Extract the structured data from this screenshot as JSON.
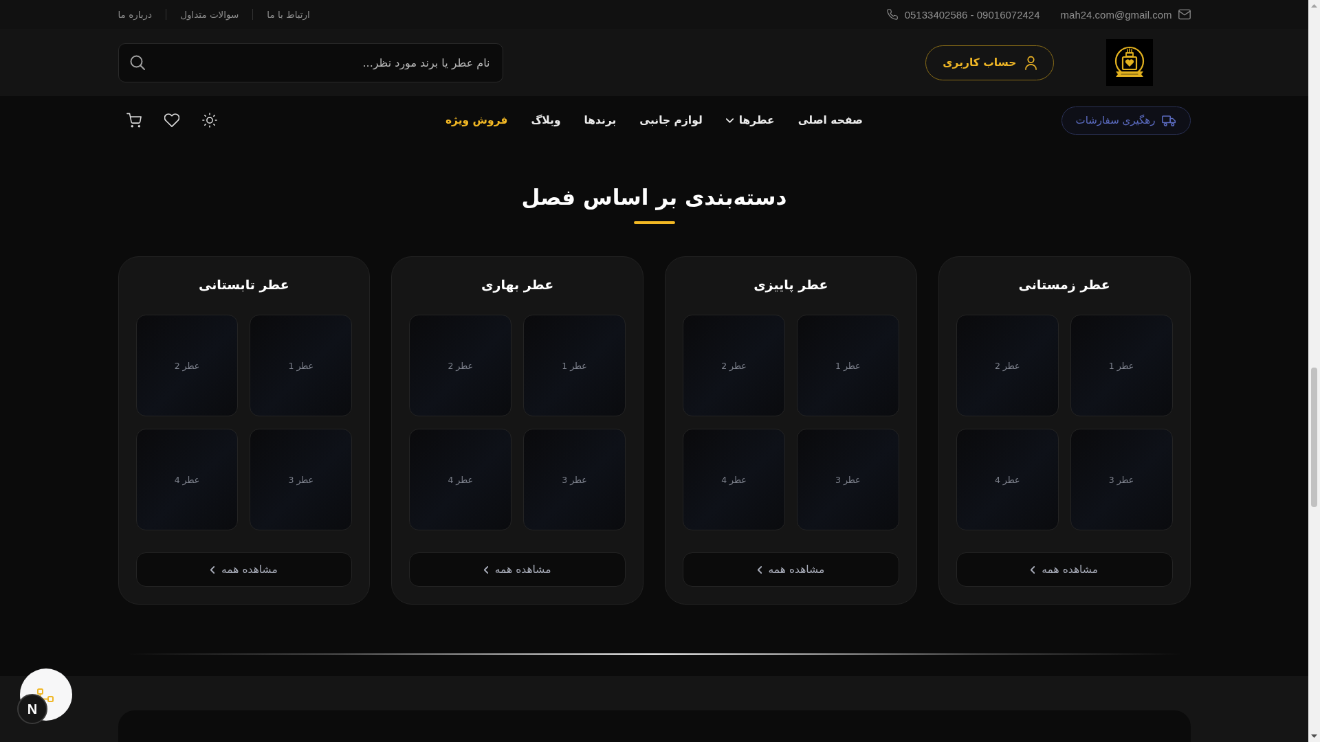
{
  "top_bar": {
    "contacts": [
      {
        "kind": "email",
        "text": "mah24.com@gmail.com"
      },
      {
        "kind": "phone",
        "text": "05133402586 - 09016072424"
      }
    ],
    "links": [
      "ارتباط با ما",
      "سوالات متداول",
      "درباره ما"
    ]
  },
  "header": {
    "account_button": "حساب کاربری",
    "search": {
      "placeholder": "نام عطر یا برند مورد نظر..."
    }
  },
  "nav": {
    "track_button": "رهگیری سفارشات",
    "items": [
      {
        "label": "صفحه اصلی",
        "kind": "link"
      },
      {
        "label": "عطرها",
        "kind": "dropdown"
      },
      {
        "label": "لوازم جانبی",
        "kind": "link"
      },
      {
        "label": "برندها",
        "kind": "link"
      },
      {
        "label": "وبلاگ",
        "kind": "link"
      },
      {
        "label": "فروش ویژه",
        "kind": "promo"
      }
    ]
  },
  "section": {
    "title": "دسته‌بندی بر اساس فصل",
    "categories": [
      {
        "title": "عطر زمستانی",
        "products": [
          "عطر 1",
          "عطر 2",
          "عطر 3",
          "عطر 4"
        ],
        "button": "مشاهده همه"
      },
      {
        "title": "عطر پاییزی",
        "products": [
          "عطر 1",
          "عطر 2",
          "عطر 3",
          "عطر 4"
        ],
        "button": "مشاهده همه"
      },
      {
        "title": "عطر بهاری",
        "products": [
          "عطر 1",
          "عطر 2",
          "عطر 3",
          "عطر 4"
        ],
        "button": "مشاهده همه"
      },
      {
        "title": "عطر تابستانی",
        "products": [
          "عطر 1",
          "عطر 2",
          "عطر 3",
          "عطر 4"
        ],
        "button": "مشاهده همه"
      }
    ]
  },
  "dev_badge": {
    "label": "N"
  }
}
